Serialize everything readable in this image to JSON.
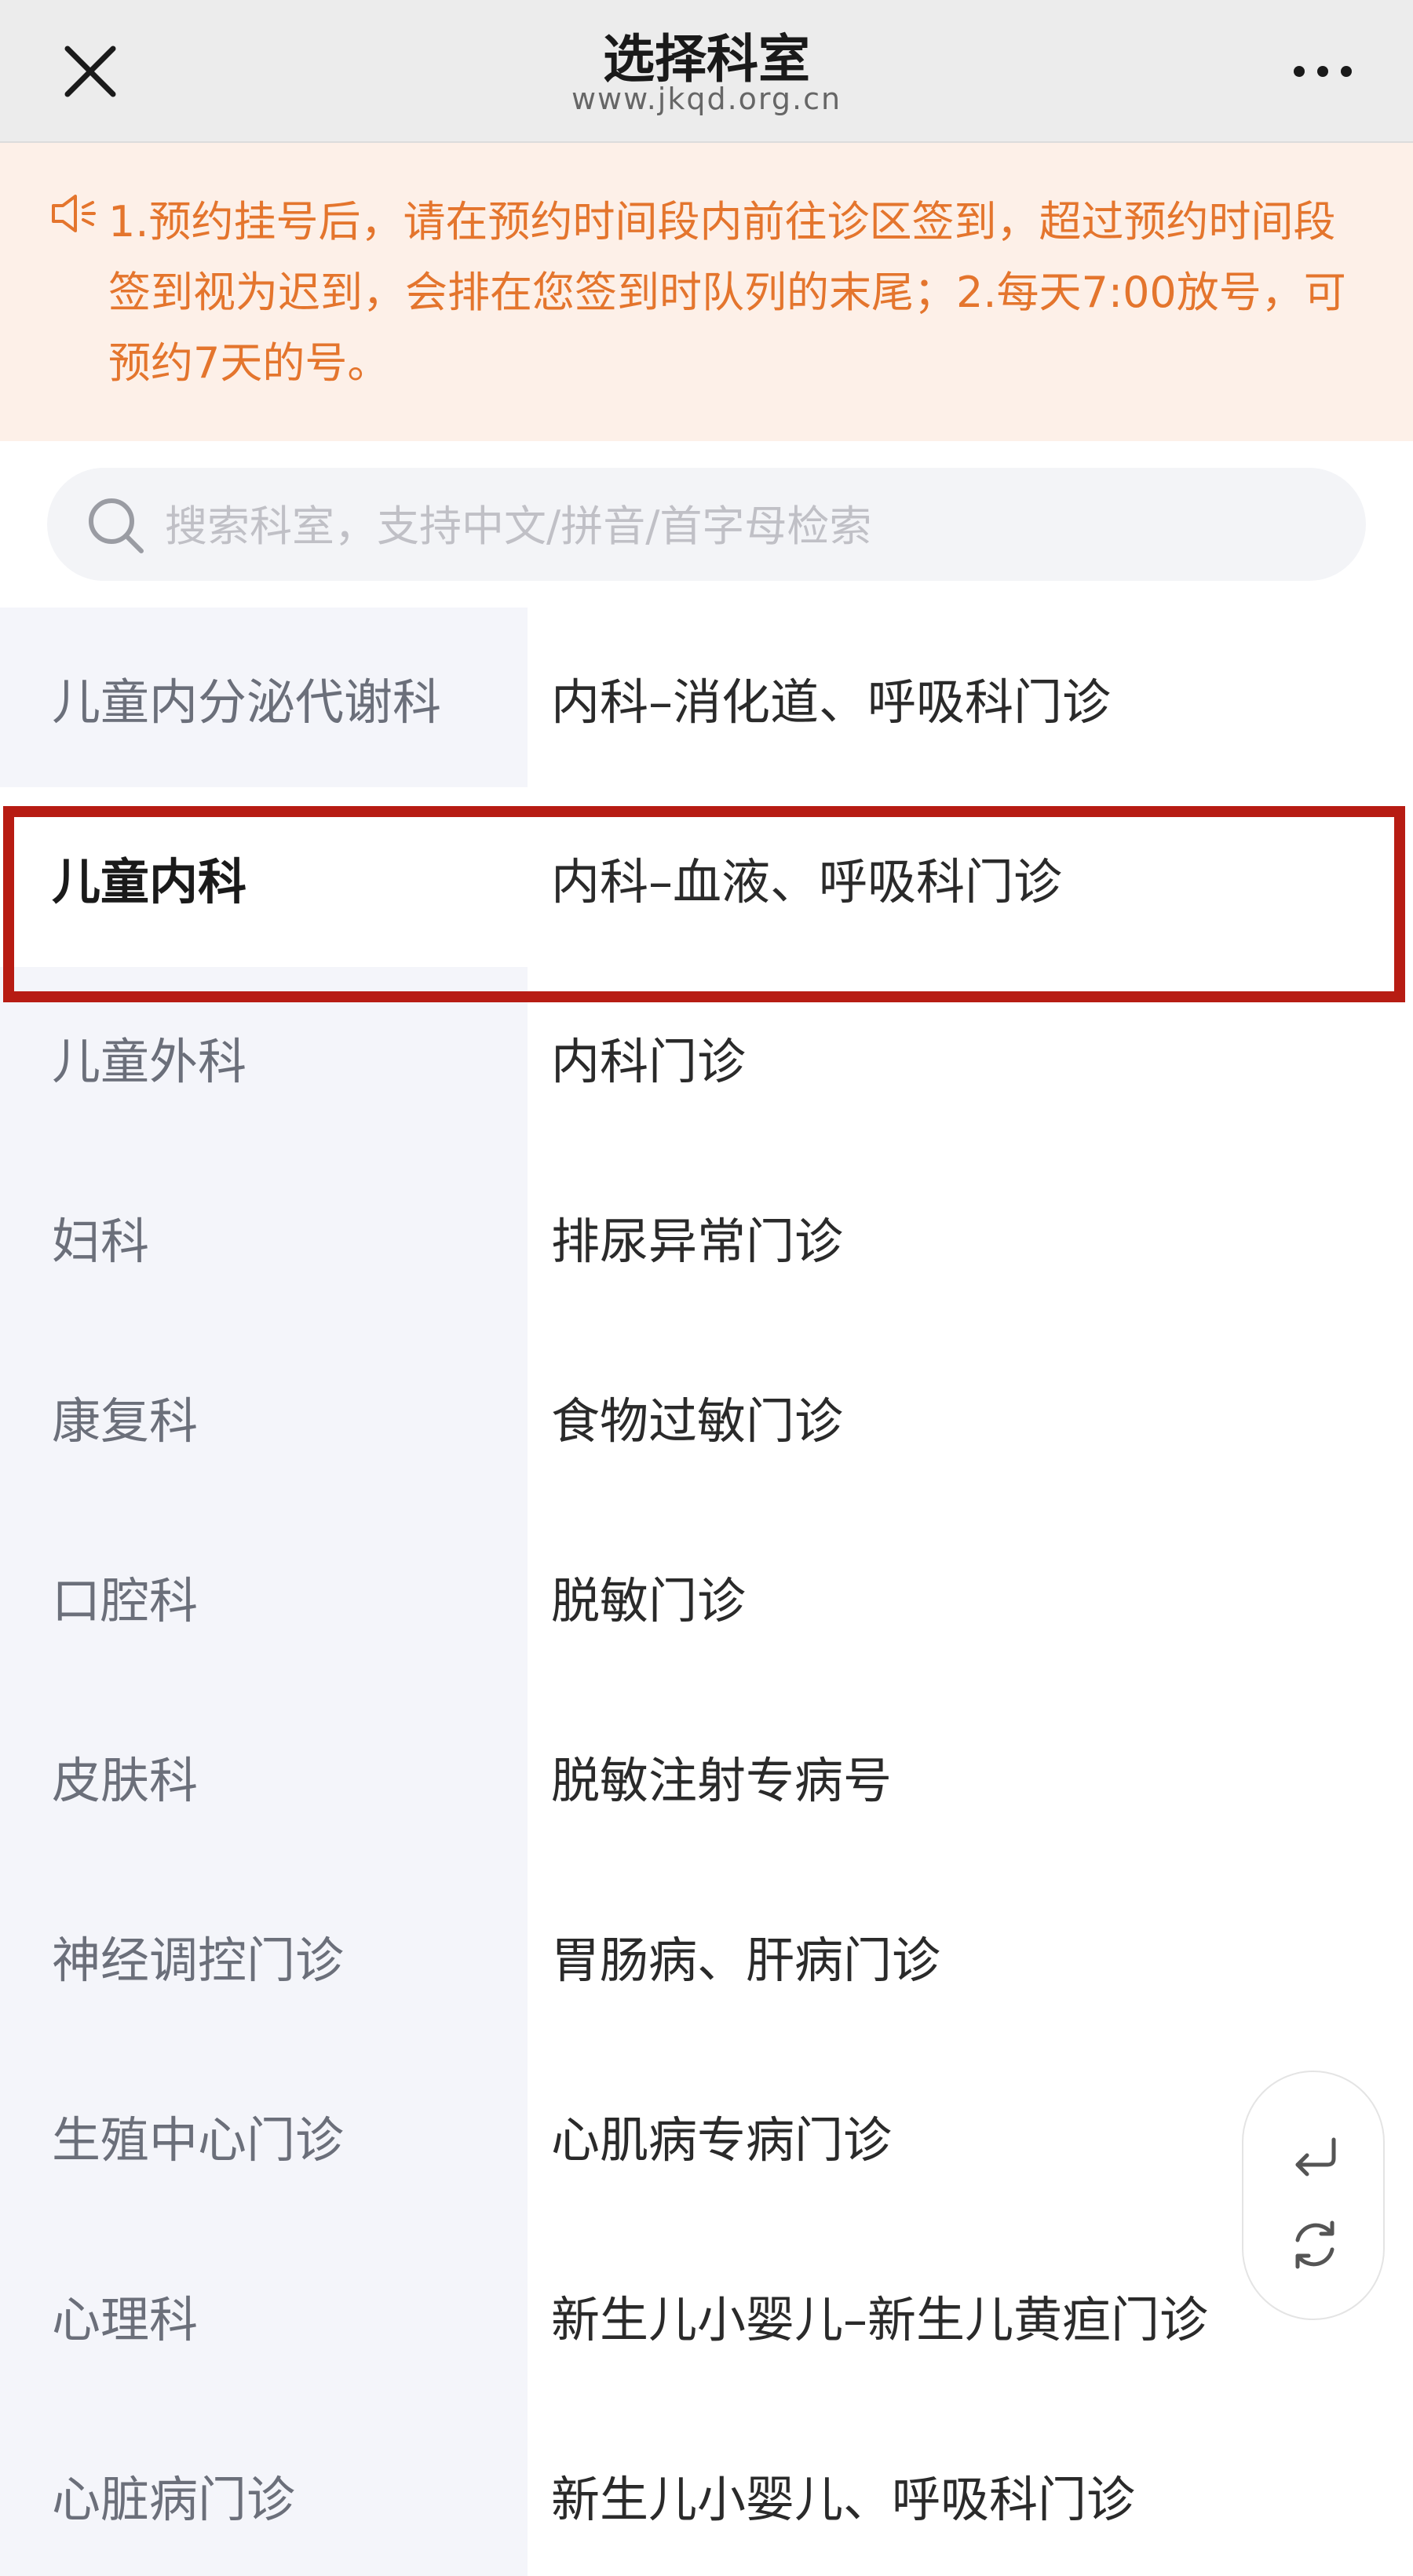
{
  "header": {
    "title": "选择科室",
    "subtitle": "www.jkqd.org.cn",
    "close_icon": "close-icon",
    "more_icon": "more-icon"
  },
  "notice": {
    "icon": "speaker-icon",
    "text": "1.预约挂号后，请在预约时间段内前往诊区签到，超过预约时间段签到视为迟到，会排在您签到时队列的末尾；2.每天7:00放号，可预约7天的号。"
  },
  "search": {
    "placeholder": "搜索科室，支持中文/拼音/首字母检索",
    "value": ""
  },
  "departments": [
    "儿童内分泌代谢科",
    "儿童内科",
    "儿童外科",
    "妇科",
    "康复科",
    "口腔科",
    "皮肤科",
    "神经调控门诊",
    "生殖中心门诊",
    "心理科",
    "心脏病门诊"
  ],
  "selected_department": "儿童内科",
  "clinics": [
    "内科–消化道、呼吸科门诊",
    "内科–血液、呼吸科门诊",
    "内科门诊",
    "排尿异常门诊",
    "食物过敏门诊",
    "脱敏门诊",
    "脱敏注射专病号",
    "胃肠病、肝病门诊",
    "心肌病专病门诊",
    "新生儿小婴儿–新生儿黄疸门诊",
    "新生儿小婴儿、呼吸科门诊"
  ],
  "floating": {
    "return_icon": "return-icon",
    "refresh_icon": "refresh-icon"
  },
  "colors": {
    "notice_bg": "#fdf0e8",
    "notice_text": "#e4752d",
    "highlight": "#b71c13",
    "left_bg": "#f4f5fa"
  }
}
